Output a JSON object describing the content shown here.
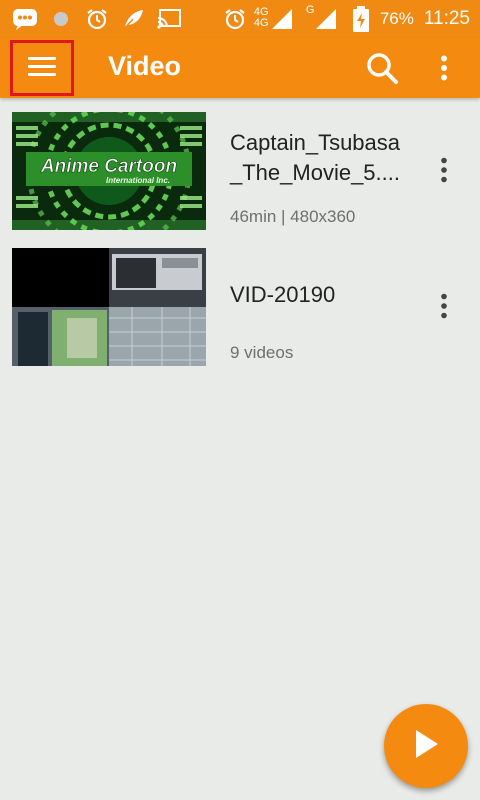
{
  "status_bar": {
    "battery_percent": "76%",
    "time": "11:25",
    "signal_label_1": "4G",
    "signal_label_2": "4G",
    "signal_label_3": "G",
    "icons": [
      "message-icon",
      "dot-icon",
      "alarm-icon",
      "leaf-icon",
      "cast-icon",
      "alarm-icon",
      "signal-icon",
      "signal-icon",
      "battery-charging-icon"
    ]
  },
  "toolbar": {
    "title": "Video",
    "menu_icon": "hamburger-menu-icon",
    "search_icon": "search-icon",
    "more_icon": "more-vert-icon"
  },
  "videos": [
    {
      "title_line1": "Captain_Tsubasa",
      "title_line2": "_The_Movie_5....",
      "meta": "46min  |  480x360",
      "thumb_text_1": "Anime Cartoon",
      "thumb_text_2": "International Inc."
    },
    {
      "title_line1": "VID-20190",
      "meta": "9 videos"
    }
  ],
  "fab": {
    "icon": "play-icon"
  },
  "colors": {
    "accent": "#f58a10",
    "status_bar": "#f18a12",
    "background": "#e8ebe8",
    "highlight": "#e0171d"
  }
}
